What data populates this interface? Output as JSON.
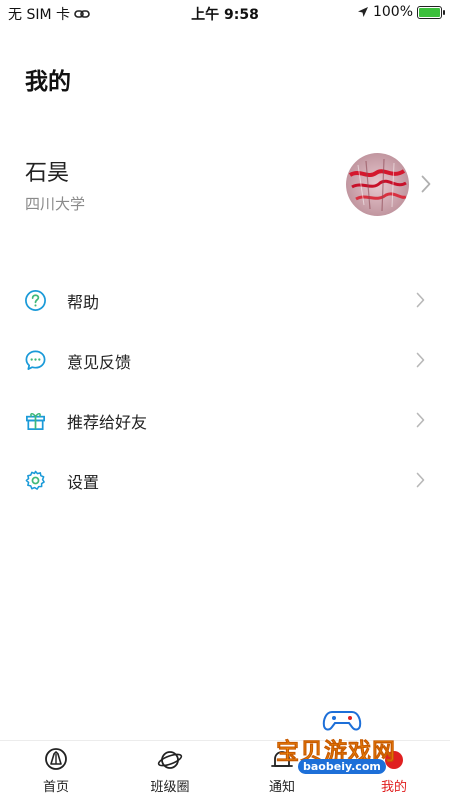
{
  "status_bar": {
    "carrier": "无 SIM 卡",
    "time": "上午 9:58",
    "battery": "100%"
  },
  "page": {
    "title": "我的"
  },
  "profile": {
    "name": "石昊",
    "school": "四川大学"
  },
  "menu": [
    {
      "label": "帮助",
      "icon": "help-icon"
    },
    {
      "label": "意见反馈",
      "icon": "feedback-icon"
    },
    {
      "label": "推荐给好友",
      "icon": "gift-icon"
    },
    {
      "label": "设置",
      "icon": "settings-icon"
    }
  ],
  "nav": [
    {
      "label": "首页",
      "icon": "home-icon"
    },
    {
      "label": "班级圈",
      "icon": "planet-icon"
    },
    {
      "label": "通知",
      "icon": "bell-icon"
    },
    {
      "label": "我的",
      "icon": "profile-icon",
      "active": true
    }
  ],
  "colors": {
    "accent": "#1a9ad8",
    "active_tab": "#e02020",
    "secondary_text": "#8a8a8a"
  },
  "watermark": {
    "text": "宝贝游戏网",
    "url": "baobeiy.com"
  }
}
